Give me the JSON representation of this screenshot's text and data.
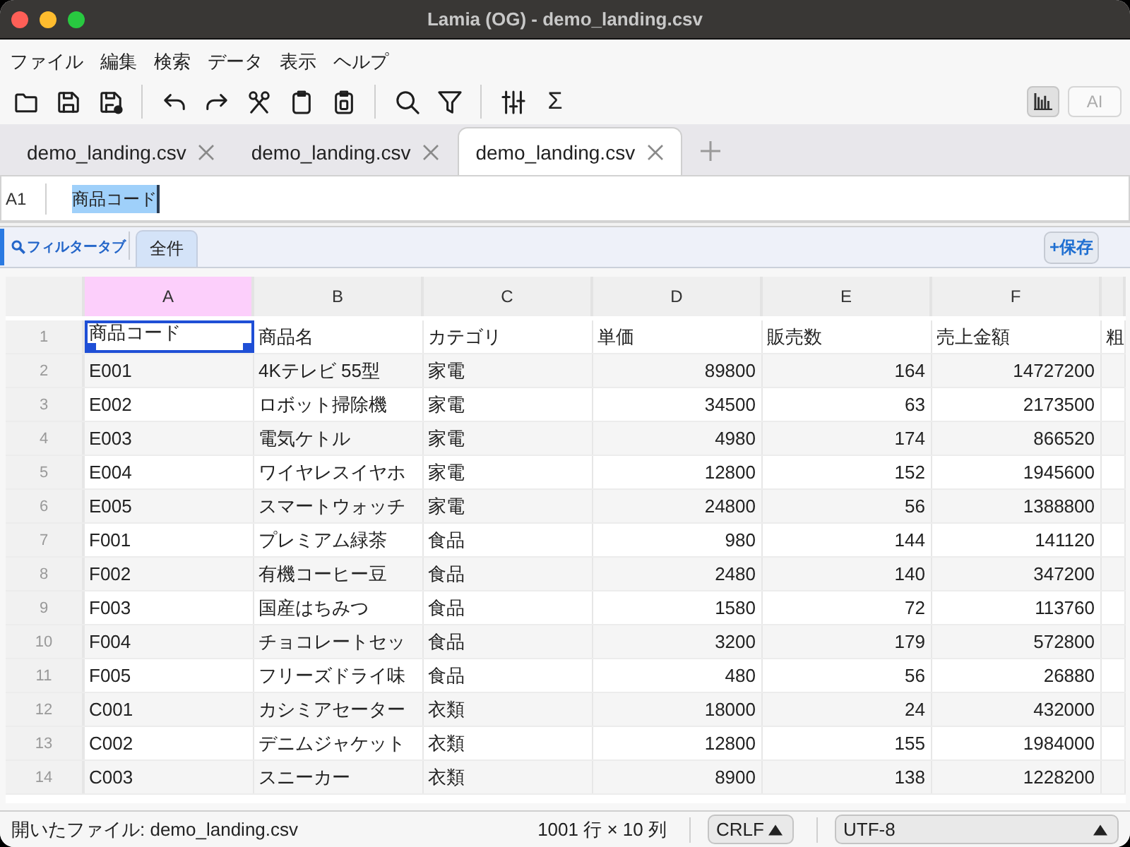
{
  "window": {
    "title": "Lamia (OG) - demo_landing.csv"
  },
  "menu": [
    "ファイル",
    "編集",
    "検索",
    "データ",
    "表示",
    "ヘルプ"
  ],
  "toolbar": {
    "sum_label": "Σ",
    "chart_toggle": {
      "on": true
    },
    "ai_button": {
      "label": "AI",
      "disabled": true
    }
  },
  "tabs": [
    {
      "label": "demo_landing.csv",
      "selected": false
    },
    {
      "label": "demo_landing.csv",
      "selected": false
    },
    {
      "label": "demo_landing.csv",
      "selected": true
    }
  ],
  "formula_bar": {
    "cell_ref": "A1",
    "value": "商品コード",
    "text_selected": true
  },
  "filter_bar": {
    "title": "フィルタータブ",
    "tabs": [
      {
        "label": "全件",
        "selected": true
      }
    ],
    "save_button": "+保存"
  },
  "grid": {
    "columns": [
      {
        "label": "A",
        "selected": true
      },
      {
        "label": "B",
        "selected": false
      },
      {
        "label": "C",
        "selected": false
      },
      {
        "label": "D",
        "selected": false
      },
      {
        "label": "E",
        "selected": false
      },
      {
        "label": "F",
        "selected": false
      }
    ],
    "rows": [
      {
        "number": "1",
        "cells": [
          {
            "text": "商品コード",
            "kind": "text",
            "selected": true
          },
          {
            "text": "商品名",
            "kind": "text",
            "selected": false
          },
          {
            "text": "カテゴリ",
            "kind": "text",
            "selected": false
          },
          {
            "text": "単価",
            "kind": "text",
            "selected": false
          },
          {
            "text": "販売数",
            "kind": "text",
            "selected": false
          },
          {
            "text": "売上金額",
            "kind": "text",
            "selected": false
          },
          {
            "text": "粗",
            "kind": "text",
            "selected": false
          }
        ]
      },
      {
        "number": "2",
        "cells": [
          {
            "text": "E001",
            "kind": "text",
            "selected": false
          },
          {
            "text": "4Kテレビ 55型",
            "kind": "text",
            "selected": false
          },
          {
            "text": "家電",
            "kind": "text",
            "selected": false
          },
          {
            "text": "89800",
            "kind": "number",
            "selected": false
          },
          {
            "text": "164",
            "kind": "number",
            "selected": false
          },
          {
            "text": "14727200",
            "kind": "number",
            "selected": false
          }
        ]
      },
      {
        "number": "3",
        "cells": [
          {
            "text": "E002",
            "kind": "text",
            "selected": false
          },
          {
            "text": "ロボット掃除機",
            "kind": "text",
            "selected": false
          },
          {
            "text": "家電",
            "kind": "text",
            "selected": false
          },
          {
            "text": "34500",
            "kind": "number",
            "selected": false
          },
          {
            "text": "63",
            "kind": "number",
            "selected": false
          },
          {
            "text": "2173500",
            "kind": "number",
            "selected": false
          }
        ]
      },
      {
        "number": "4",
        "cells": [
          {
            "text": "E003",
            "kind": "text",
            "selected": false
          },
          {
            "text": "電気ケトル",
            "kind": "text",
            "selected": false
          },
          {
            "text": "家電",
            "kind": "text",
            "selected": false
          },
          {
            "text": "4980",
            "kind": "number",
            "selected": false
          },
          {
            "text": "174",
            "kind": "number",
            "selected": false
          },
          {
            "text": "866520",
            "kind": "number",
            "selected": false
          }
        ]
      },
      {
        "number": "5",
        "cells": [
          {
            "text": "E004",
            "kind": "text",
            "selected": false
          },
          {
            "text": "ワイヤレスイヤホ",
            "kind": "text",
            "selected": false
          },
          {
            "text": "家電",
            "kind": "text",
            "selected": false
          },
          {
            "text": "12800",
            "kind": "number",
            "selected": false
          },
          {
            "text": "152",
            "kind": "number",
            "selected": false
          },
          {
            "text": "1945600",
            "kind": "number",
            "selected": false
          }
        ]
      },
      {
        "number": "6",
        "cells": [
          {
            "text": "E005",
            "kind": "text",
            "selected": false
          },
          {
            "text": "スマートウォッチ",
            "kind": "text",
            "selected": false
          },
          {
            "text": "家電",
            "kind": "text",
            "selected": false
          },
          {
            "text": "24800",
            "kind": "number",
            "selected": false
          },
          {
            "text": "56",
            "kind": "number",
            "selected": false
          },
          {
            "text": "1388800",
            "kind": "number",
            "selected": false
          }
        ]
      },
      {
        "number": "7",
        "cells": [
          {
            "text": "F001",
            "kind": "text",
            "selected": false
          },
          {
            "text": "プレミアム緑茶",
            "kind": "text",
            "selected": false
          },
          {
            "text": "食品",
            "kind": "text",
            "selected": false
          },
          {
            "text": "980",
            "kind": "number",
            "selected": false
          },
          {
            "text": "144",
            "kind": "number",
            "selected": false
          },
          {
            "text": "141120",
            "kind": "number",
            "selected": false
          }
        ]
      },
      {
        "number": "8",
        "cells": [
          {
            "text": "F002",
            "kind": "text",
            "selected": false
          },
          {
            "text": "有機コーヒー豆",
            "kind": "text",
            "selected": false
          },
          {
            "text": "食品",
            "kind": "text",
            "selected": false
          },
          {
            "text": "2480",
            "kind": "number",
            "selected": false
          },
          {
            "text": "140",
            "kind": "number",
            "selected": false
          },
          {
            "text": "347200",
            "kind": "number",
            "selected": false
          }
        ]
      },
      {
        "number": "9",
        "cells": [
          {
            "text": "F003",
            "kind": "text",
            "selected": false
          },
          {
            "text": "国産はちみつ",
            "kind": "text",
            "selected": false
          },
          {
            "text": "食品",
            "kind": "text",
            "selected": false
          },
          {
            "text": "1580",
            "kind": "number",
            "selected": false
          },
          {
            "text": "72",
            "kind": "number",
            "selected": false
          },
          {
            "text": "113760",
            "kind": "number",
            "selected": false
          }
        ]
      },
      {
        "number": "10",
        "cells": [
          {
            "text": "F004",
            "kind": "text",
            "selected": false
          },
          {
            "text": "チョコレートセッ",
            "kind": "text",
            "selected": false
          },
          {
            "text": "食品",
            "kind": "text",
            "selected": false
          },
          {
            "text": "3200",
            "kind": "number",
            "selected": false
          },
          {
            "text": "179",
            "kind": "number",
            "selected": false
          },
          {
            "text": "572800",
            "kind": "number",
            "selected": false
          }
        ]
      },
      {
        "number": "11",
        "cells": [
          {
            "text": "F005",
            "kind": "text",
            "selected": false
          },
          {
            "text": "フリーズドライ味",
            "kind": "text",
            "selected": false
          },
          {
            "text": "食品",
            "kind": "text",
            "selected": false
          },
          {
            "text": "480",
            "kind": "number",
            "selected": false
          },
          {
            "text": "56",
            "kind": "number",
            "selected": false
          },
          {
            "text": "26880",
            "kind": "number",
            "selected": false
          }
        ]
      },
      {
        "number": "12",
        "cells": [
          {
            "text": "C001",
            "kind": "text",
            "selected": false
          },
          {
            "text": "カシミアセーター",
            "kind": "text",
            "selected": false
          },
          {
            "text": "衣類",
            "kind": "text",
            "selected": false
          },
          {
            "text": "18000",
            "kind": "number",
            "selected": false
          },
          {
            "text": "24",
            "kind": "number",
            "selected": false
          },
          {
            "text": "432000",
            "kind": "number",
            "selected": false
          }
        ]
      },
      {
        "number": "13",
        "cells": [
          {
            "text": "C002",
            "kind": "text",
            "selected": false
          },
          {
            "text": "デニムジャケット",
            "kind": "text",
            "selected": false
          },
          {
            "text": "衣類",
            "kind": "text",
            "selected": false
          },
          {
            "text": "12800",
            "kind": "number",
            "selected": false
          },
          {
            "text": "155",
            "kind": "number",
            "selected": false
          },
          {
            "text": "1984000",
            "kind": "number",
            "selected": false
          }
        ]
      },
      {
        "number": "14",
        "cells": [
          {
            "text": "C003",
            "kind": "text",
            "selected": false
          },
          {
            "text": "スニーカー",
            "kind": "text",
            "selected": false
          },
          {
            "text": "衣類",
            "kind": "text",
            "selected": false
          },
          {
            "text": "8900",
            "kind": "number",
            "selected": false
          },
          {
            "text": "138",
            "kind": "number",
            "selected": false
          },
          {
            "text": "1228200",
            "kind": "number",
            "selected": false
          }
        ]
      }
    ]
  },
  "status_bar": {
    "file": "開いたファイル: demo_landing.csv",
    "size": "1001 行 × 10 列",
    "line_ending": "CRLF",
    "encoding": "UTF-8"
  }
}
